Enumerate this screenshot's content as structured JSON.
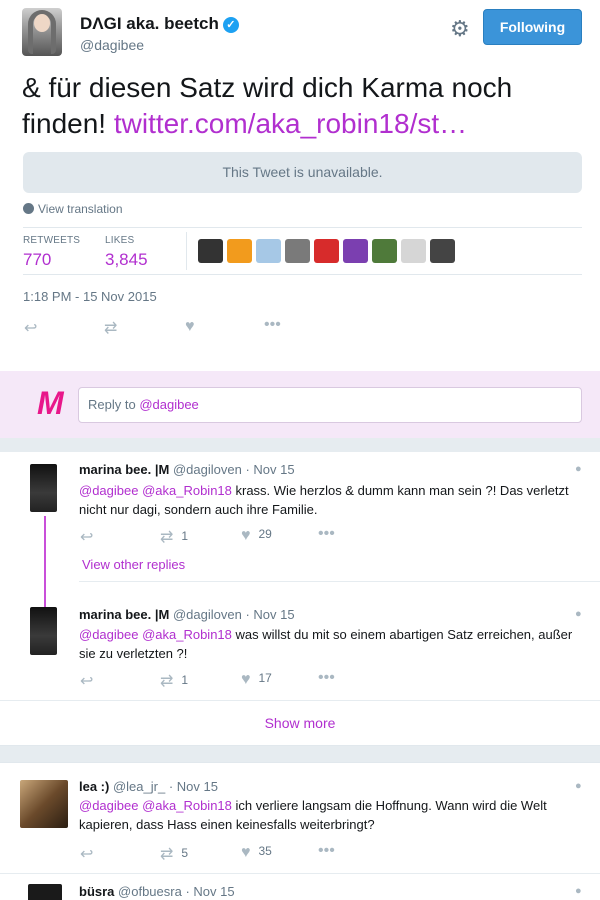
{
  "header": {
    "name": "DΛGI aka. beetch",
    "handle": "@dagibee",
    "follow_label": "Following"
  },
  "tweet": {
    "text": "& für diesen Satz wird dich Karma noch finden!",
    "link": "twitter.com/aka_robin18/st…",
    "unavailable": "This Tweet is unavailable.",
    "translate": "View translation",
    "retweets_label": "RETWEETS",
    "retweets": "770",
    "likes_label": "LIKES",
    "likes": "3,845",
    "timestamp": "1:18 PM - 15 Nov 2015"
  },
  "likers_colors": [
    "#333333",
    "#f29b1d",
    "#a6c8e6",
    "#7a7a7a",
    "#d72b2b",
    "#7b3fb0",
    "#4f7a3a",
    "#d6d6d6",
    "#444444"
  ],
  "reply_box": {
    "prefix": "Reply to ",
    "mention": "@dagibee"
  },
  "replies": [
    {
      "name": "marina bee. |M",
      "handle": "@dagiloven",
      "time": "Nov 15",
      "mentions": "@dagibee @aka_Robin18",
      "text": " krass. Wie herzlos & dumm kann man sein ?! Das verletzt nicht nur dagi, sondern auch ihre Familie.",
      "retweets": "1",
      "likes": "29"
    },
    {
      "name": "marina bee. |M",
      "handle": "@dagiloven",
      "time": "Nov 15",
      "mentions": "@dagibee @aka_Robin18",
      "text": " was willst du mit so einem abartigen Satz erreichen, außer sie zu verletzten ?!",
      "retweets": "1",
      "likes": "17"
    },
    {
      "name": "lea :)",
      "handle": "@lea_jr_",
      "time": "Nov 15",
      "mentions": "@dagibee @aka_Robin18",
      "text": " ich verliere langsam die Hoffnung. Wann wird die Welt kapieren, dass Hass einen keinesfalls weiterbringt?",
      "retweets": "5",
      "likes": "35"
    },
    {
      "name": "büsra",
      "handle": "@ofbuesra",
      "time": "Nov 15"
    }
  ],
  "view_other_replies": "View other replies",
  "show_more": "Show more",
  "dot": "·"
}
